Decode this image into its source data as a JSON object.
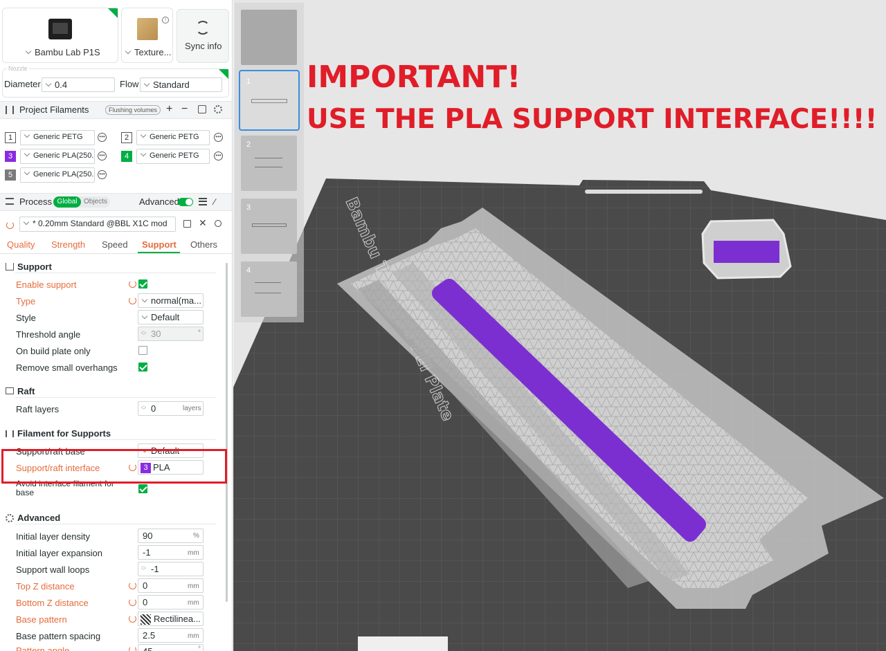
{
  "printer": {
    "name": "Bambu Lab P1S",
    "plate": "Texture...",
    "sync_label": "Sync info",
    "nozzle_label": "Nozzle"
  },
  "nozzle": {
    "diameter_label": "Diameter",
    "diameter": "0.4",
    "flow_label": "Flow",
    "flow": "Standard"
  },
  "filaments": {
    "title": "Project Filaments",
    "flushing_label": "Flushing volumes",
    "items": [
      {
        "num": "1",
        "name": "Generic PETG",
        "color": "#ffffff"
      },
      {
        "num": "2",
        "name": "Generic PETG",
        "color": "#ffffff"
      },
      {
        "num": "3",
        "name": "Generic PLA(250...",
        "color": "#8a2be2"
      },
      {
        "num": "4",
        "name": "Generic PETG",
        "color": "#00ae42"
      },
      {
        "num": "5",
        "name": "Generic PLA(250...",
        "color": "#7a7a7a"
      }
    ]
  },
  "process": {
    "title": "Process",
    "global_label": "Global",
    "objects_label": "Objects",
    "advanced_label": "Advanced",
    "preset": "* 0.20mm Standard @BBL X1C mod",
    "tabs": [
      "Quality",
      "Strength",
      "Speed",
      "Support",
      "Others"
    ]
  },
  "support": {
    "title": "Support",
    "enable_label": "Enable support",
    "type_label": "Type",
    "type_value": "normal(ma...",
    "style_label": "Style",
    "style_value": "Default",
    "threshold_label": "Threshold angle",
    "threshold_value": "30",
    "build_plate_label": "On build plate only",
    "remove_label": "Remove small overhangs"
  },
  "raft": {
    "title": "Raft",
    "layers_label": "Raft layers",
    "layers_value": "0",
    "layers_unit": "layers"
  },
  "filament_supports": {
    "title": "Filament for Supports",
    "base_label": "Support/raft base",
    "base_value": "Default",
    "interface_label": "Support/raft interface",
    "interface_num": "3",
    "interface_value": "PLA",
    "avoid_label_1": "Avoid interface filament for",
    "avoid_label_2": "base"
  },
  "advanced": {
    "title": "Advanced",
    "rows": [
      {
        "label": "Initial layer density",
        "value": "90",
        "unit": "%"
      },
      {
        "label": "Initial layer expansion",
        "value": "-1",
        "unit": "mm"
      },
      {
        "label": "Support wall loops",
        "value": "-1",
        "unit": ""
      },
      {
        "label": "Top Z distance",
        "value": "0",
        "unit": "mm"
      },
      {
        "label": "Bottom Z distance",
        "value": "0",
        "unit": "mm"
      },
      {
        "label": "Base pattern",
        "value": "Rectilinea...",
        "unit": ""
      },
      {
        "label": "Base pattern spacing",
        "value": "2.5",
        "unit": "mm"
      },
      {
        "label": "Pattern angle",
        "value": "45",
        "unit": "°"
      }
    ]
  },
  "plates": [
    "1",
    "2",
    "3",
    "4"
  ],
  "warning": {
    "line1": "IMPORTANT!",
    "line2": "USE THE PLA SUPPORT INTERFACE!!!!"
  },
  "bed_label": "Bambu Textured PEI Plate",
  "colors": {
    "accent": "#00ae42",
    "orange": "#e66b3c",
    "warning": "#e01d28",
    "purple": "#7b2fd0"
  }
}
